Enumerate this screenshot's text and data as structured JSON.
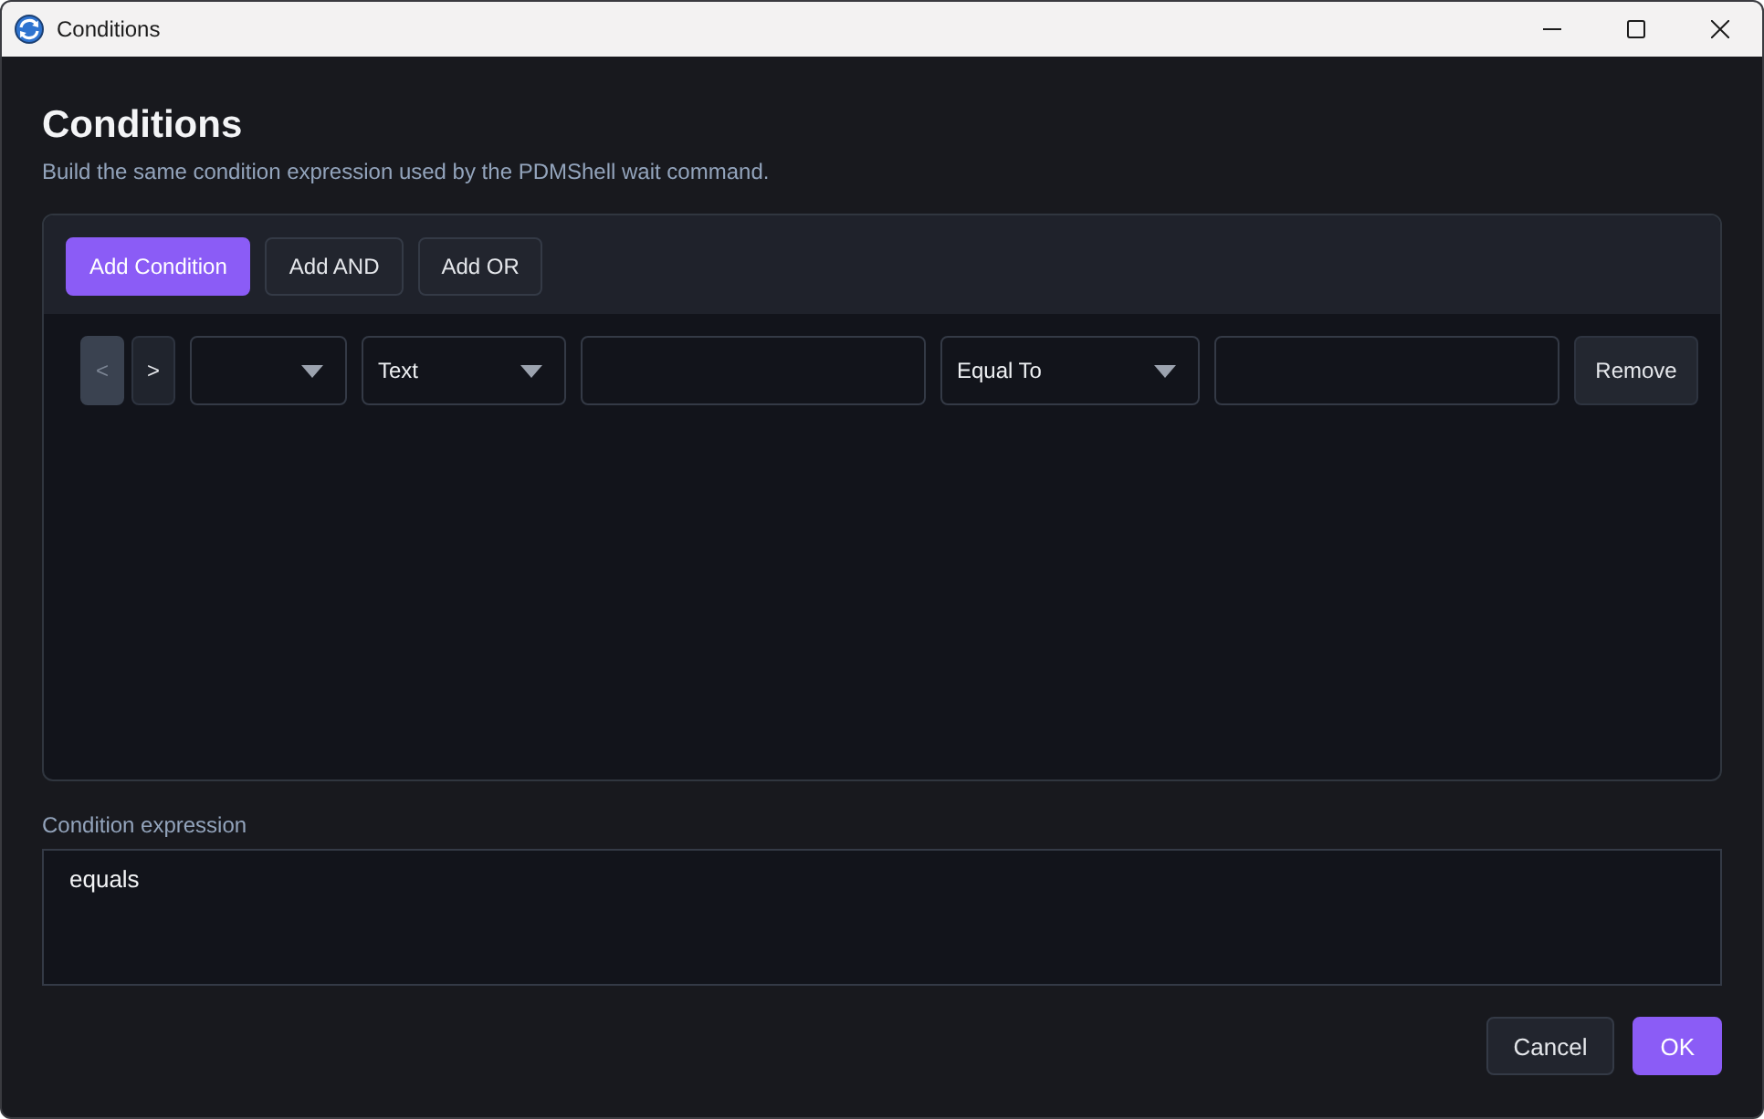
{
  "window": {
    "title": "Conditions"
  },
  "header": {
    "title": "Conditions",
    "subtitle": "Build the same condition expression used by the PDMShell wait command."
  },
  "toolbar": {
    "buttons": [
      {
        "label": "Add Condition",
        "kind": "primary"
      },
      {
        "label": "Add AND",
        "kind": "secondary"
      },
      {
        "label": "Add OR",
        "kind": "secondary"
      }
    ]
  },
  "conditions": [
    {
      "controls": [
        {
          "kind": "button",
          "label": "<",
          "disabled": true
        },
        {
          "kind": "button",
          "label": ">",
          "disabled": false
        },
        {
          "kind": "dropdown"
        },
        {
          "kind": "dropdown",
          "value": "Text"
        },
        {
          "kind": "input"
        },
        {
          "kind": "dropdown",
          "value": "Equal To"
        },
        {
          "kind": "input"
        },
        {
          "kind": "button",
          "label": "Remove",
          "disabled": false
        }
      ]
    }
  ],
  "expression": {
    "label": "Condition expression",
    "value": "equals"
  },
  "footer": {
    "buttons": [
      {
        "label": "Cancel",
        "kind": "secondary"
      },
      {
        "label": "OK",
        "kind": "primary"
      }
    ]
  }
}
